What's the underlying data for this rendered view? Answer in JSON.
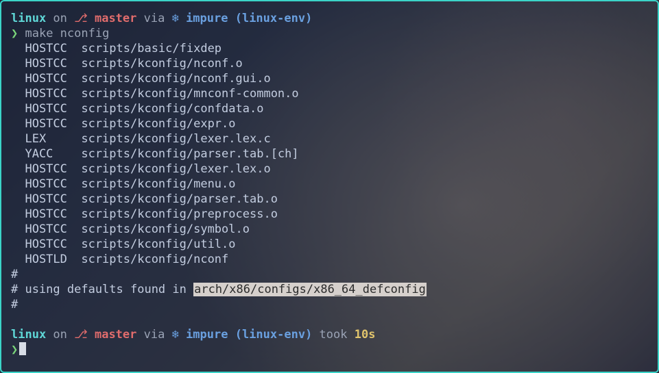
{
  "prompt1": {
    "dir": "linux",
    "on": " on ",
    "branch_icon": "⎇",
    "branch": " master",
    "via": " via ",
    "env_icon": "❄",
    "impure": " impure",
    "env_name": " (linux-env)",
    "symbol": "❯",
    "command": " make nconfig"
  },
  "build_lines": [
    {
      "tag": "HOSTCC",
      "path": "scripts/basic/fixdep"
    },
    {
      "tag": "HOSTCC",
      "path": "scripts/kconfig/nconf.o"
    },
    {
      "tag": "HOSTCC",
      "path": "scripts/kconfig/nconf.gui.o"
    },
    {
      "tag": "HOSTCC",
      "path": "scripts/kconfig/mnconf-common.o"
    },
    {
      "tag": "HOSTCC",
      "path": "scripts/kconfig/confdata.o"
    },
    {
      "tag": "HOSTCC",
      "path": "scripts/kconfig/expr.o"
    },
    {
      "tag": "LEX",
      "path": "scripts/kconfig/lexer.lex.c"
    },
    {
      "tag": "YACC",
      "path": "scripts/kconfig/parser.tab.[ch]"
    },
    {
      "tag": "HOSTCC",
      "path": "scripts/kconfig/lexer.lex.o"
    },
    {
      "tag": "HOSTCC",
      "path": "scripts/kconfig/menu.o"
    },
    {
      "tag": "HOSTCC",
      "path": "scripts/kconfig/parser.tab.o"
    },
    {
      "tag": "HOSTCC",
      "path": "scripts/kconfig/preprocess.o"
    },
    {
      "tag": "HOSTCC",
      "path": "scripts/kconfig/symbol.o"
    },
    {
      "tag": "HOSTCC",
      "path": "scripts/kconfig/util.o"
    },
    {
      "tag": "HOSTLD",
      "path": "scripts/kconfig/nconf"
    }
  ],
  "defaults": {
    "hash1": "#",
    "prefix": "# using defaults found in ",
    "path": "arch/x86/configs/x86_64_defconfig",
    "hash2": "#"
  },
  "prompt2": {
    "dir": "linux",
    "on": " on ",
    "branch_icon": "⎇",
    "branch": " master",
    "via": " via ",
    "env_icon": "❄",
    "impure": " impure",
    "env_name": " (linux-env)",
    "took": " took ",
    "duration": "10s",
    "symbol": "❯"
  }
}
